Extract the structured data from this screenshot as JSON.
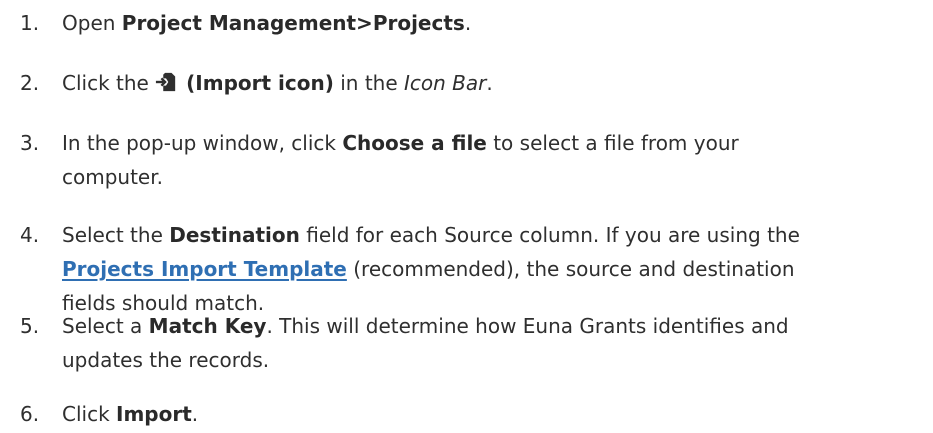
{
  "steps": [
    {
      "number": "1.",
      "pre": "Open ",
      "bold": "Project Management>Projects",
      "post": "."
    },
    {
      "number": "2.",
      "pre": "Click the ",
      "icon": "import-icon",
      "bold": " (Import icon)",
      "mid": " in the ",
      "italic": "Icon Bar",
      "post": "."
    },
    {
      "number": "3.",
      "pre": "In the pop-up window, click ",
      "bold": "Choose a file",
      "post_line1": " to select a file from your",
      "post_line2": "computer."
    },
    {
      "number": "4.",
      "pre": "Select the ",
      "bold": "Destination",
      "post_line1": " field for each Source column. If you are using the",
      "link": "Projects Import Template",
      "post_line2": " (recommended), the source and destination",
      "post_line3": "fields should match."
    },
    {
      "number": "5.",
      "pre": "Select a ",
      "bold": "Match Key",
      "post_line1": ". This will determine how Euna Grants identifies and",
      "post_line2": "updates the records."
    },
    {
      "number": "6.",
      "pre": "Click ",
      "bold": "Import",
      "post": "."
    }
  ],
  "colors": {
    "text": "#2f2f2f",
    "link": "#2f6fb3"
  }
}
